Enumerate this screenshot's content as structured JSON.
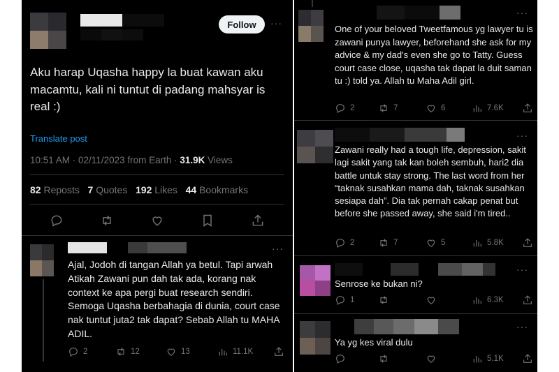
{
  "main_post": {
    "follow_label": "Follow",
    "more": "···",
    "body": "Aku harap Uqasha happy la buat kawan aku macamtu, kali ni tuntut di padang mahsyar is real :)",
    "translate": "Translate post",
    "time": "10:51 AM · 02/11/2023 from Earth · ",
    "views_count": "31.9K",
    "views_label": " Views",
    "stats": {
      "reposts_count": "82",
      "reposts_label": "Reposts",
      "quotes_count": "7",
      "quotes_label": "Quotes",
      "likes_count": "192",
      "likes_label": "Likes",
      "bookmarks_count": "44",
      "bookmarks_label": "Bookmarks"
    }
  },
  "left_reply": {
    "more": "···",
    "body": "Ajal, Jodoh di tangan Allah ya betul. Tapi arwah Atikah Zawani pun dah tak ada, korang nak context ke apa pergi buat research sendiri. Semoga Uqasha berbahagia di dunia, court case nak tuntut juta2 tak dapat? Sebab Allah tu MAHA ADIL.",
    "replies": "2",
    "reposts": "12",
    "likes": "13",
    "views": "11.1K"
  },
  "right_replies": [
    {
      "more": "···",
      "body": "One of your beloved Tweetfamous yg lawyer tu is zawani punya lawyer, beforehand she ask for my advice & my dad's even she go to Tatty. Guess court case close, uqasha tak dapat la duit saman tu :) told ya. Allah tu Maha Adil girl.",
      "replies": "2",
      "reposts": "7",
      "likes": "6",
      "views": "7.6K"
    },
    {
      "more": "···",
      "body": "Zawani really had a tough life, depression, sakit lagi sakit yang tak kan boleh sembuh, hari2 dia battle untuk stay strong. The last word from her “taknak susahkan mama dah, taknak susahkan sesiapa dah”. Dia tak pernah cakap penat but before she passed away, she said i'm tired..",
      "replies": "2",
      "reposts": "7",
      "likes": "5",
      "views": "5.8K"
    },
    {
      "more": "···",
      "body": "Senrose ke bukan ni?",
      "replies": "1",
      "reposts": "",
      "likes": "",
      "views": "6.3K"
    },
    {
      "more": "···",
      "body": "Ya yg kes viral dulu",
      "replies": "",
      "reposts": "",
      "likes": "",
      "views": "5.1K"
    }
  ],
  "colors": {
    "background": "#000000",
    "text": "#e7e9ea",
    "muted": "#71767b",
    "link": "#1d9bf0",
    "divider": "#2f3336",
    "follow_bg": "#eff3f4"
  },
  "icons": [
    "reply-icon",
    "repost-icon",
    "like-icon",
    "bookmark-icon",
    "share-icon",
    "views-icon",
    "more-icon"
  ]
}
